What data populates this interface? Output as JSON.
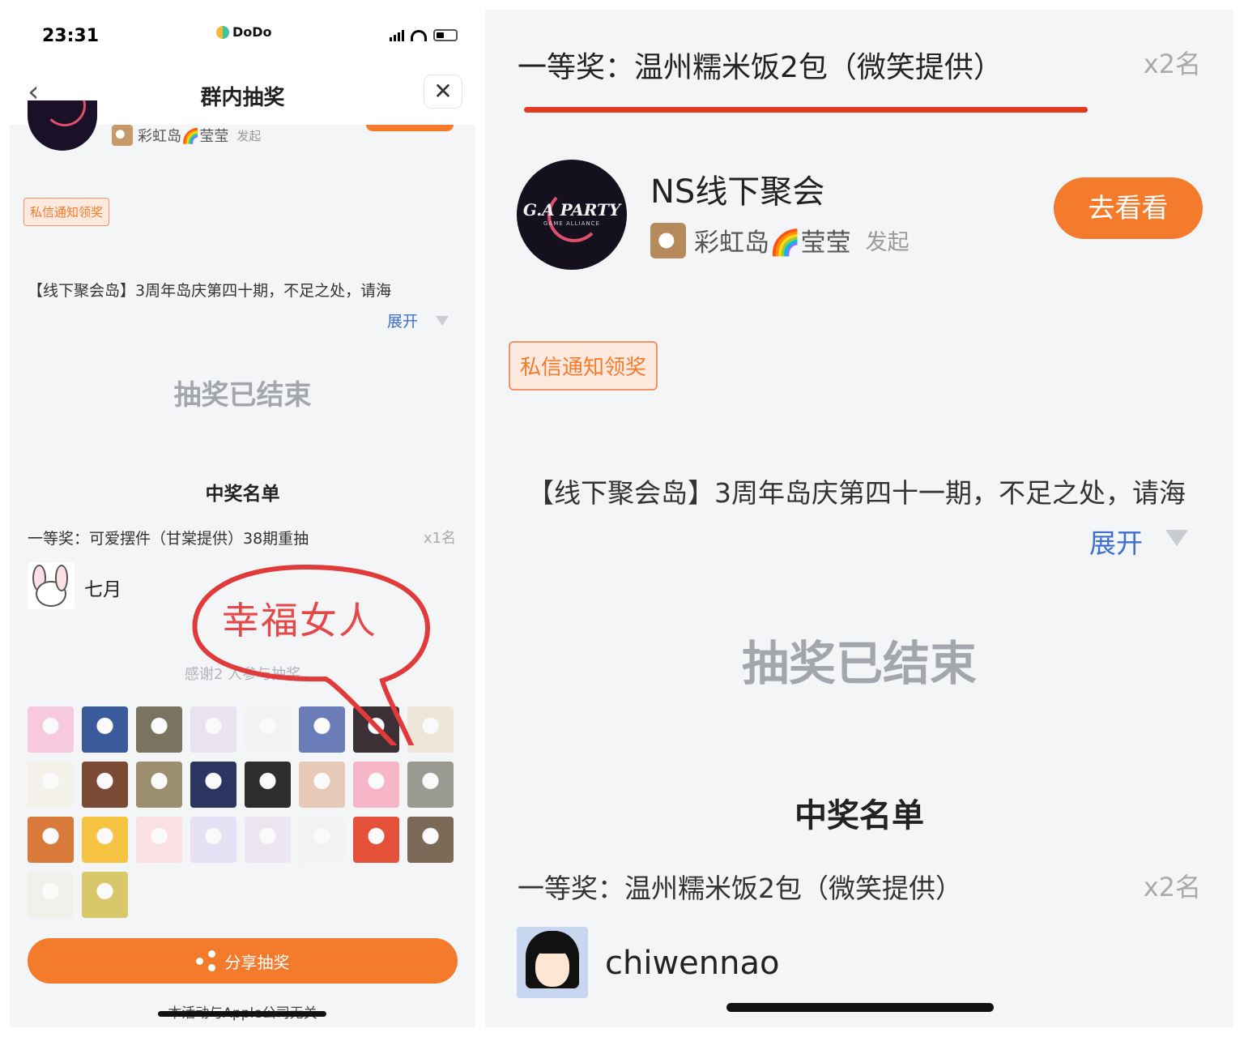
{
  "left": {
    "status": {
      "time": "23:31",
      "brand": "DoDo"
    },
    "nav": {
      "back": "‹",
      "title": "群内抽奖",
      "close": "✕"
    },
    "host": {
      "name": "彩虹岛🌈莹莹",
      "by": "发起"
    },
    "tag": "私信通知领奖",
    "description": "【线下聚会岛】3周年岛庆第四十期，不足之处，请海",
    "expand": "展开",
    "ended": "抽奖已结束",
    "winners": {
      "title": "中奖名单",
      "prize": "一等奖：可爱摆件（甘棠提供）38期重抽",
      "count": "x1名",
      "winner_name": "七月"
    },
    "thanks": "感谢2 人参与抽奖",
    "participant_colors": [
      "#f6c9dc",
      "#3a5a9c",
      "#7a7360",
      "#e9e3ef",
      "#f2f2f2",
      "#6b7db8",
      "#3b3036",
      "#efe6da",
      "#f4f1ea",
      "#7a4a35",
      "#9c8f6e",
      "#2a3660",
      "#2d2d2d",
      "#e7c9b7",
      "#f6b6c8",
      "#9a9a92",
      "#d97a3a",
      "#f6c343",
      "#fbe1e4",
      "#e6e0f4",
      "#ece6f2",
      "#f2f2f2",
      "#e4503a",
      "#7c6a58",
      "#eef2ea",
      "#d8c86a"
    ],
    "share": "分享抽奖",
    "footer": "本活动与Apple公司无关"
  },
  "annotation": {
    "text": "幸福女人",
    "color": "#e54848"
  },
  "right": {
    "header_prize": "一等奖：温州糯米饭2包（微笑提供）",
    "header_count": "x2名",
    "event": {
      "logo_text": "G.A PARTY",
      "logo_sub": "GAME ALLIANCE",
      "name": "NS线下聚会",
      "host": "彩虹岛🌈莹莹",
      "by": "发起",
      "go": "去看看"
    },
    "tag": "私信通知领奖",
    "description": "【线下聚会岛】3周年岛庆第四十一期，不足之处，请海",
    "expand": "展开",
    "ended": "抽奖已结束",
    "winners": {
      "title": "中奖名单",
      "prize": "一等奖：温州糯米饭2包（微笑提供）",
      "count": "x2名",
      "winner_name": "chiwennao"
    }
  },
  "colors": {
    "accent": "#f47a2c",
    "link": "#3d6fd2",
    "muted": "#a3a6ad",
    "underline": "#e43a22"
  }
}
